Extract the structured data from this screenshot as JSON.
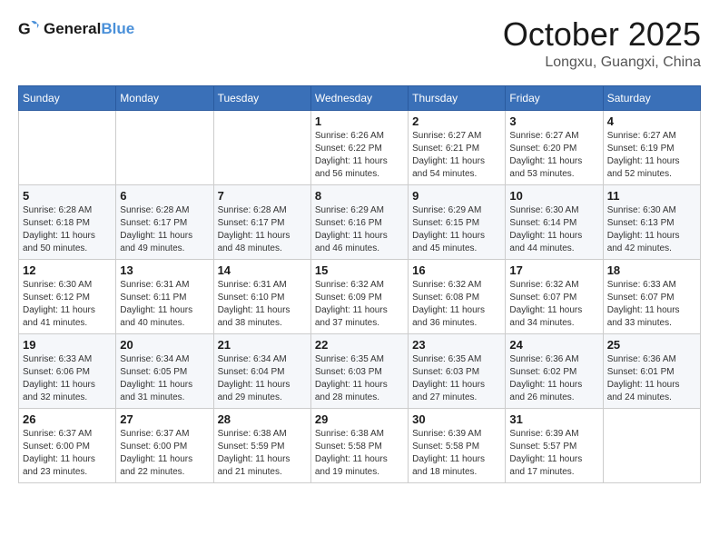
{
  "header": {
    "logo_text_general": "General",
    "logo_text_blue": "Blue",
    "month_title": "October 2025",
    "location": "Longxu, Guangxi, China"
  },
  "weekdays": [
    "Sunday",
    "Monday",
    "Tuesday",
    "Wednesday",
    "Thursday",
    "Friday",
    "Saturday"
  ],
  "weeks": [
    [
      {
        "day": "",
        "info": ""
      },
      {
        "day": "",
        "info": ""
      },
      {
        "day": "",
        "info": ""
      },
      {
        "day": "1",
        "info": "Sunrise: 6:26 AM\nSunset: 6:22 PM\nDaylight: 11 hours\nand 56 minutes."
      },
      {
        "day": "2",
        "info": "Sunrise: 6:27 AM\nSunset: 6:21 PM\nDaylight: 11 hours\nand 54 minutes."
      },
      {
        "day": "3",
        "info": "Sunrise: 6:27 AM\nSunset: 6:20 PM\nDaylight: 11 hours\nand 53 minutes."
      },
      {
        "day": "4",
        "info": "Sunrise: 6:27 AM\nSunset: 6:19 PM\nDaylight: 11 hours\nand 52 minutes."
      }
    ],
    [
      {
        "day": "5",
        "info": "Sunrise: 6:28 AM\nSunset: 6:18 PM\nDaylight: 11 hours\nand 50 minutes."
      },
      {
        "day": "6",
        "info": "Sunrise: 6:28 AM\nSunset: 6:17 PM\nDaylight: 11 hours\nand 49 minutes."
      },
      {
        "day": "7",
        "info": "Sunrise: 6:28 AM\nSunset: 6:17 PM\nDaylight: 11 hours\nand 48 minutes."
      },
      {
        "day": "8",
        "info": "Sunrise: 6:29 AM\nSunset: 6:16 PM\nDaylight: 11 hours\nand 46 minutes."
      },
      {
        "day": "9",
        "info": "Sunrise: 6:29 AM\nSunset: 6:15 PM\nDaylight: 11 hours\nand 45 minutes."
      },
      {
        "day": "10",
        "info": "Sunrise: 6:30 AM\nSunset: 6:14 PM\nDaylight: 11 hours\nand 44 minutes."
      },
      {
        "day": "11",
        "info": "Sunrise: 6:30 AM\nSunset: 6:13 PM\nDaylight: 11 hours\nand 42 minutes."
      }
    ],
    [
      {
        "day": "12",
        "info": "Sunrise: 6:30 AM\nSunset: 6:12 PM\nDaylight: 11 hours\nand 41 minutes."
      },
      {
        "day": "13",
        "info": "Sunrise: 6:31 AM\nSunset: 6:11 PM\nDaylight: 11 hours\nand 40 minutes."
      },
      {
        "day": "14",
        "info": "Sunrise: 6:31 AM\nSunset: 6:10 PM\nDaylight: 11 hours\nand 38 minutes."
      },
      {
        "day": "15",
        "info": "Sunrise: 6:32 AM\nSunset: 6:09 PM\nDaylight: 11 hours\nand 37 minutes."
      },
      {
        "day": "16",
        "info": "Sunrise: 6:32 AM\nSunset: 6:08 PM\nDaylight: 11 hours\nand 36 minutes."
      },
      {
        "day": "17",
        "info": "Sunrise: 6:32 AM\nSunset: 6:07 PM\nDaylight: 11 hours\nand 34 minutes."
      },
      {
        "day": "18",
        "info": "Sunrise: 6:33 AM\nSunset: 6:07 PM\nDaylight: 11 hours\nand 33 minutes."
      }
    ],
    [
      {
        "day": "19",
        "info": "Sunrise: 6:33 AM\nSunset: 6:06 PM\nDaylight: 11 hours\nand 32 minutes."
      },
      {
        "day": "20",
        "info": "Sunrise: 6:34 AM\nSunset: 6:05 PM\nDaylight: 11 hours\nand 31 minutes."
      },
      {
        "day": "21",
        "info": "Sunrise: 6:34 AM\nSunset: 6:04 PM\nDaylight: 11 hours\nand 29 minutes."
      },
      {
        "day": "22",
        "info": "Sunrise: 6:35 AM\nSunset: 6:03 PM\nDaylight: 11 hours\nand 28 minutes."
      },
      {
        "day": "23",
        "info": "Sunrise: 6:35 AM\nSunset: 6:03 PM\nDaylight: 11 hours\nand 27 minutes."
      },
      {
        "day": "24",
        "info": "Sunrise: 6:36 AM\nSunset: 6:02 PM\nDaylight: 11 hours\nand 26 minutes."
      },
      {
        "day": "25",
        "info": "Sunrise: 6:36 AM\nSunset: 6:01 PM\nDaylight: 11 hours\nand 24 minutes."
      }
    ],
    [
      {
        "day": "26",
        "info": "Sunrise: 6:37 AM\nSunset: 6:00 PM\nDaylight: 11 hours\nand 23 minutes."
      },
      {
        "day": "27",
        "info": "Sunrise: 6:37 AM\nSunset: 6:00 PM\nDaylight: 11 hours\nand 22 minutes."
      },
      {
        "day": "28",
        "info": "Sunrise: 6:38 AM\nSunset: 5:59 PM\nDaylight: 11 hours\nand 21 minutes."
      },
      {
        "day": "29",
        "info": "Sunrise: 6:38 AM\nSunset: 5:58 PM\nDaylight: 11 hours\nand 19 minutes."
      },
      {
        "day": "30",
        "info": "Sunrise: 6:39 AM\nSunset: 5:58 PM\nDaylight: 11 hours\nand 18 minutes."
      },
      {
        "day": "31",
        "info": "Sunrise: 6:39 AM\nSunset: 5:57 PM\nDaylight: 11 hours\nand 17 minutes."
      },
      {
        "day": "",
        "info": ""
      }
    ]
  ]
}
